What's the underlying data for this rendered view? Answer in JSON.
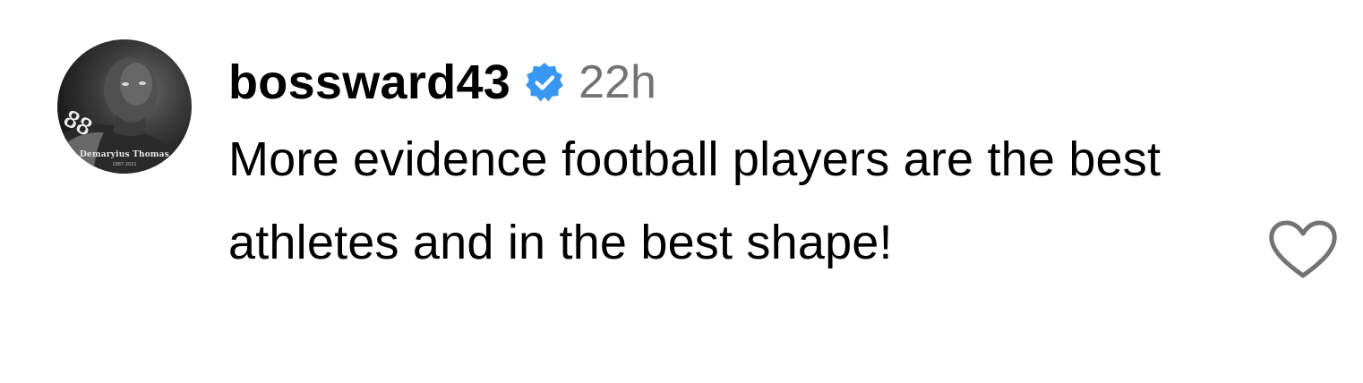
{
  "comment": {
    "avatar": {
      "alt": "profile photo",
      "caption": "Demaryius Thomas",
      "years": "1987-2021",
      "jersey_number": "88"
    },
    "username": "bossward43",
    "verified_icon": "verified-badge-icon",
    "timestamp": "22h",
    "text": "More evidence football players are the best athletes and in the best shape!",
    "like_icon": "heart-outline-icon"
  },
  "colors": {
    "verified_blue": "#3897f0",
    "timestamp_gray": "#737373",
    "heart_gray": "#737373",
    "text": "#000000",
    "background": "#ffffff"
  }
}
